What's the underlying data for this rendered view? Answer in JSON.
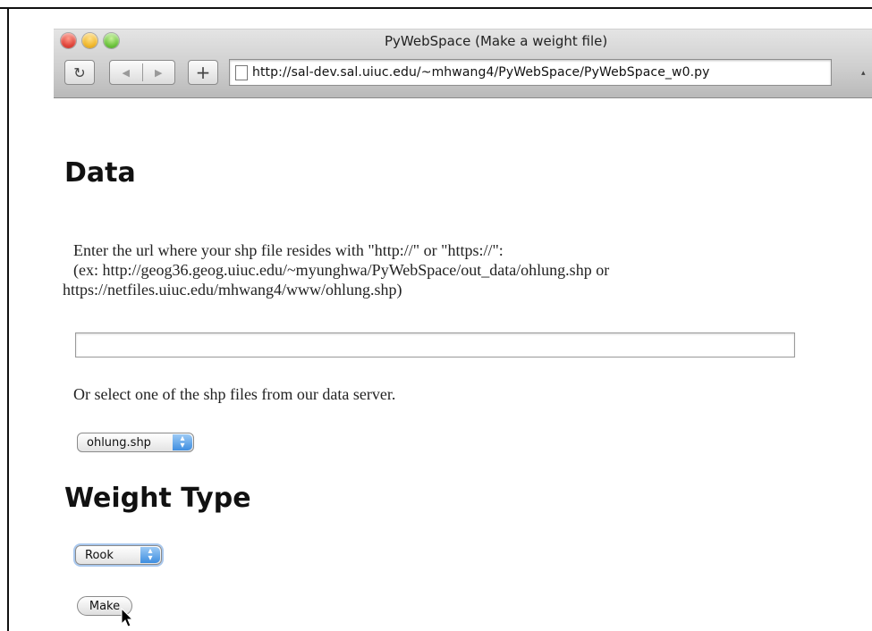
{
  "window": {
    "title": "PyWebSpace (Make a weight file)",
    "url": "http://sal-dev.sal.uiuc.edu/~mhwang4/PyWebSpace/PyWebSpace_w0.py"
  },
  "toolbar": {
    "reload_icon": "reload-icon",
    "back_icon": "back-arrow-icon",
    "forward_icon": "forward-arrow-icon",
    "add_icon": "plus-icon"
  },
  "data_section": {
    "heading": "Data",
    "instruction_line1": "Enter the url where your shp file resides with \"http://\" or \"https://\":",
    "instruction_line2": "(ex: http://geog36.geog.uiuc.edu/~myunghwa/PyWebSpace/out_data/ohlung.shp or",
    "instruction_line3": "https://netfiles.uiuc.edu/mhwang4/www/ohlung.shp)",
    "url_input_value": "",
    "select_prompt": "Or select one of the shp files from our data server.",
    "shp_select_value": "ohlung.shp"
  },
  "weight_section": {
    "heading": "Weight Type",
    "weight_select_value": "Rook",
    "make_button_label": "Make"
  }
}
